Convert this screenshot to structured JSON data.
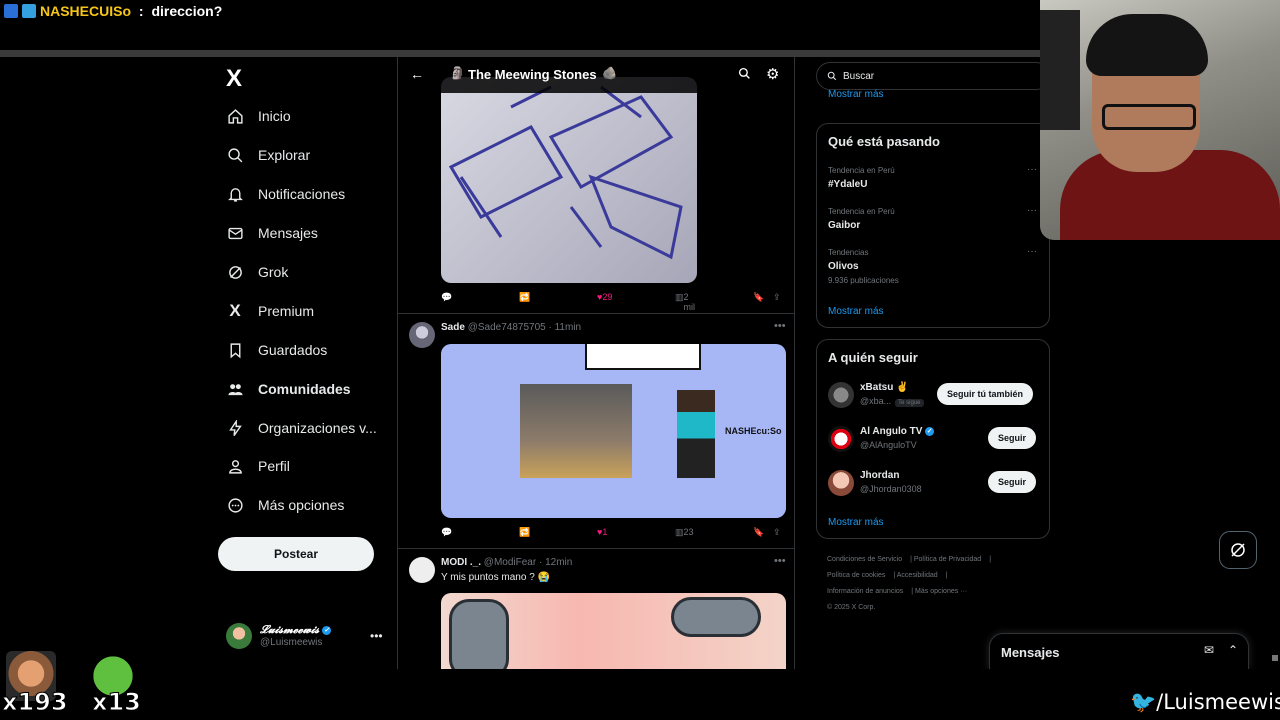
{
  "stream": {
    "chat_user": "NASHECUISo",
    "chat_sep": " : ",
    "chat_text": "direccion?",
    "emotes": [
      {
        "name": "emote-laughing-man",
        "count": "x193"
      },
      {
        "name": "emote-pepe",
        "count": "x13"
      }
    ],
    "channel_handle": "/Luismeewis"
  },
  "nav": {
    "logo": "X",
    "items": [
      {
        "label": "Inicio",
        "icon": "home-icon"
      },
      {
        "label": "Explorar",
        "icon": "search-icon"
      },
      {
        "label": "Notificaciones",
        "icon": "bell-icon"
      },
      {
        "label": "Mensajes",
        "icon": "mail-icon"
      },
      {
        "label": "Grok",
        "icon": "grok-icon"
      },
      {
        "label": "Premium",
        "icon": "x-icon"
      },
      {
        "label": "Guardados",
        "icon": "bookmark-icon"
      },
      {
        "label": "Comunidades",
        "icon": "people-icon"
      },
      {
        "label": "Organizaciones v...",
        "icon": "lightning-icon"
      },
      {
        "label": "Perfil",
        "icon": "person-icon"
      },
      {
        "label": "Más opciones",
        "icon": "more-circle-icon"
      }
    ],
    "post_label": "Postear",
    "account": {
      "name": "𝓛𝓾𝓲𝓼𝓶𝓮𝓮𝔀𝓲𝓼",
      "handle": "@Luismeewis"
    }
  },
  "main": {
    "title": "The Meewing Stones",
    "tweets": [
      {
        "likes": "29",
        "views": "2 mil"
      },
      {
        "name": "Sade",
        "handle": "@Sade74875705",
        "time": "11min",
        "likes": "1",
        "views": "23",
        "image_label": "NASHEcu:So"
      },
      {
        "name": "MODI ._.",
        "handle": "@ModiFear",
        "time": "12min",
        "text": "Y mis puntos mano ? 😭"
      }
    ]
  },
  "right": {
    "search_placeholder": "Buscar",
    "show_more": "Mostrar más",
    "trends_title": "Qué está pasando",
    "trends": [
      {
        "category": "Tendencia en Perú",
        "name": "#YdaleU"
      },
      {
        "category": "Tendencia en Perú",
        "name": "Gaibor"
      },
      {
        "category": "Tendencias",
        "name": "Olivos",
        "posts": "9.936 publicaciones"
      }
    ],
    "follow_title": "A quién seguir",
    "follow": [
      {
        "name": "xBatsu ✌",
        "handle": "@xba...",
        "follows_you": "Te sigue",
        "button": "Seguir tú también"
      },
      {
        "name": "Al Angulo TV",
        "handle": "@AlAnguloTV",
        "button": "Seguir"
      },
      {
        "name": "Jhordan",
        "handle": "@Jhordan0308",
        "button": "Seguir"
      }
    ],
    "footer": {
      "terms": "Condiciones de Servicio",
      "privacy": "Política de Privacidad",
      "cookies": "Política de cookies",
      "accessibility": "Accesibilidad",
      "ads": "Información de anuncios",
      "more": "Más opciones ···",
      "copyright": "© 2025 X Corp."
    }
  },
  "messages_drawer": {
    "title": "Mensajes"
  }
}
